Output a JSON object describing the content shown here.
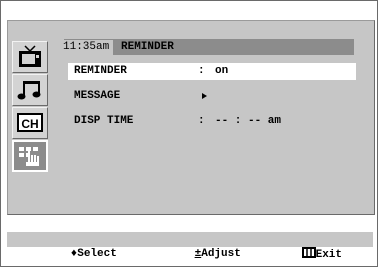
{
  "header": {
    "time": "11:35am",
    "title": "REMINDER"
  },
  "sidebar": {
    "items": [
      {
        "icon": "tv-icon"
      },
      {
        "icon": "music-note-icon"
      },
      {
        "icon": "channel-icon",
        "label": "CH"
      },
      {
        "icon": "hand-grid-icon",
        "selected": true
      }
    ]
  },
  "menu": {
    "rows": [
      {
        "label": "REMINDER",
        "separator": ":",
        "value": "on",
        "highlighted": true
      },
      {
        "label": "MESSAGE",
        "value": "▸"
      },
      {
        "label": "DISP TIME",
        "separator": ":",
        "value": "-- : -- am"
      }
    ]
  },
  "help": {
    "select_icon": "♦",
    "select_label": "Select",
    "adjust_icon": "±",
    "adjust_label": "Adjust",
    "exit_icon": "exit-icon",
    "exit_label": "Exit"
  },
  "colors": {
    "panel": "#c6c6c6",
    "title_bar": "#8c8c8c",
    "highlight": "#ffffff"
  }
}
